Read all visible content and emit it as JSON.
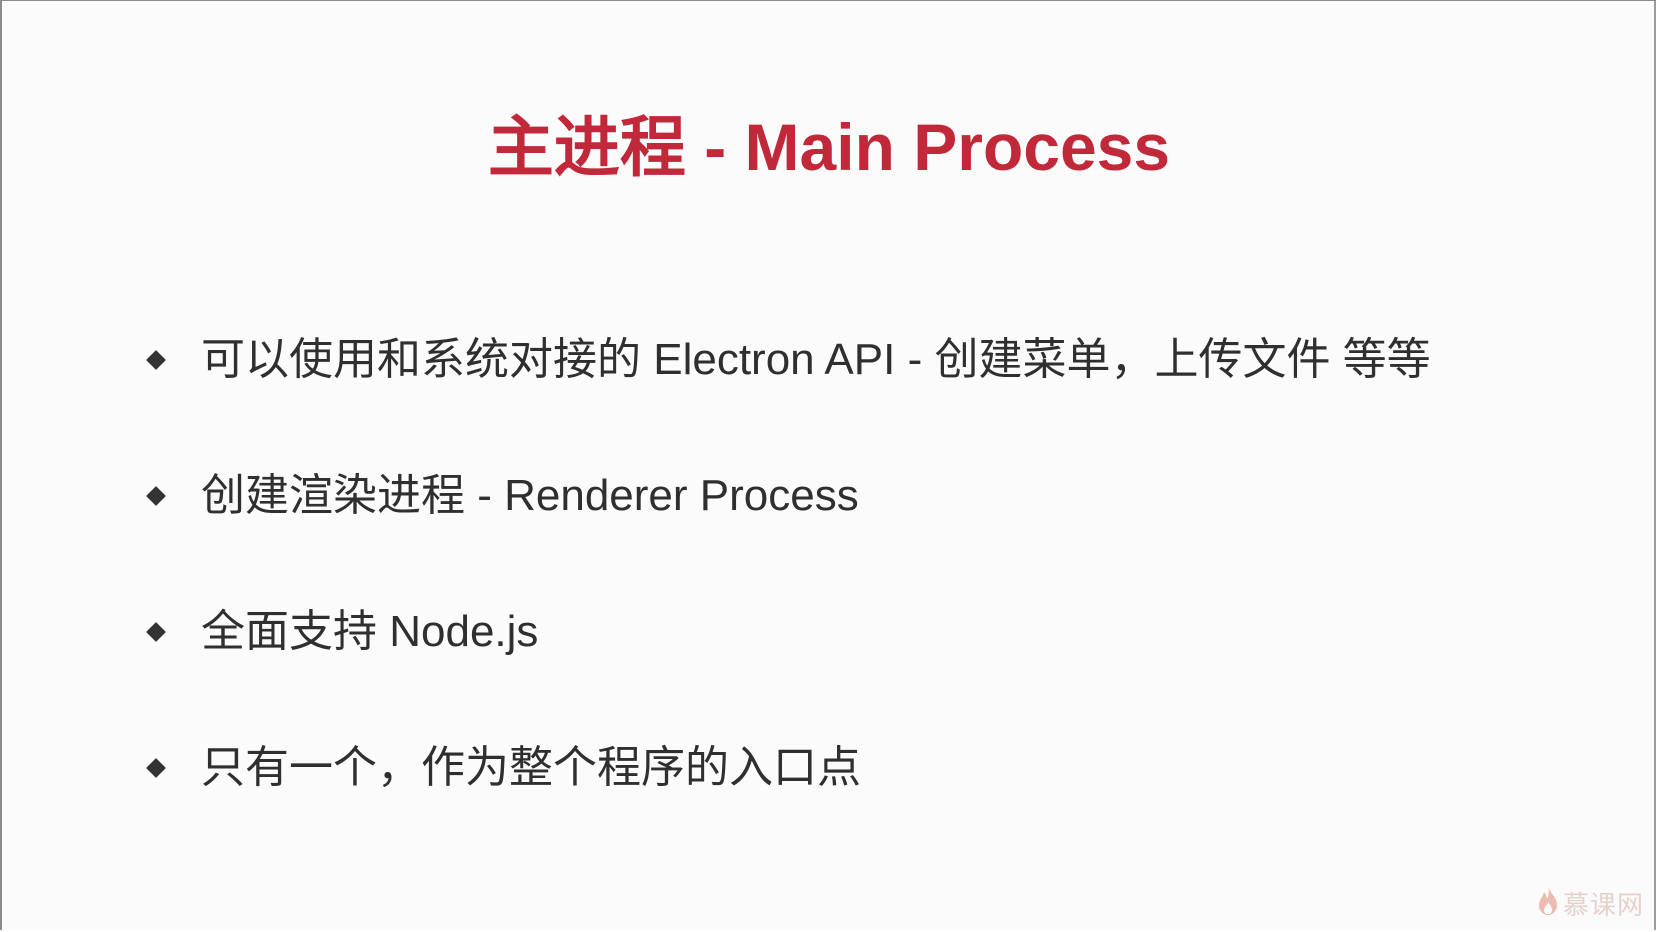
{
  "slide": {
    "title": "主进程 - Main Process",
    "bullets": [
      {
        "text": "可以使用和系统对接的 Electron API - 创建菜单，上传文件 等等"
      },
      {
        "text": "创建渲染进程 - Renderer Process"
      },
      {
        "text": "全面支持 Node.js"
      },
      {
        "text": "只有一个，作为整个程序的入口点"
      }
    ]
  },
  "watermark": {
    "text": "慕课网",
    "icon": "flame-icon"
  },
  "colors": {
    "title": "#c1283a",
    "body_text": "#2f2f2f",
    "background": "#fbfbfb",
    "watermark": "#d8b0a8"
  }
}
